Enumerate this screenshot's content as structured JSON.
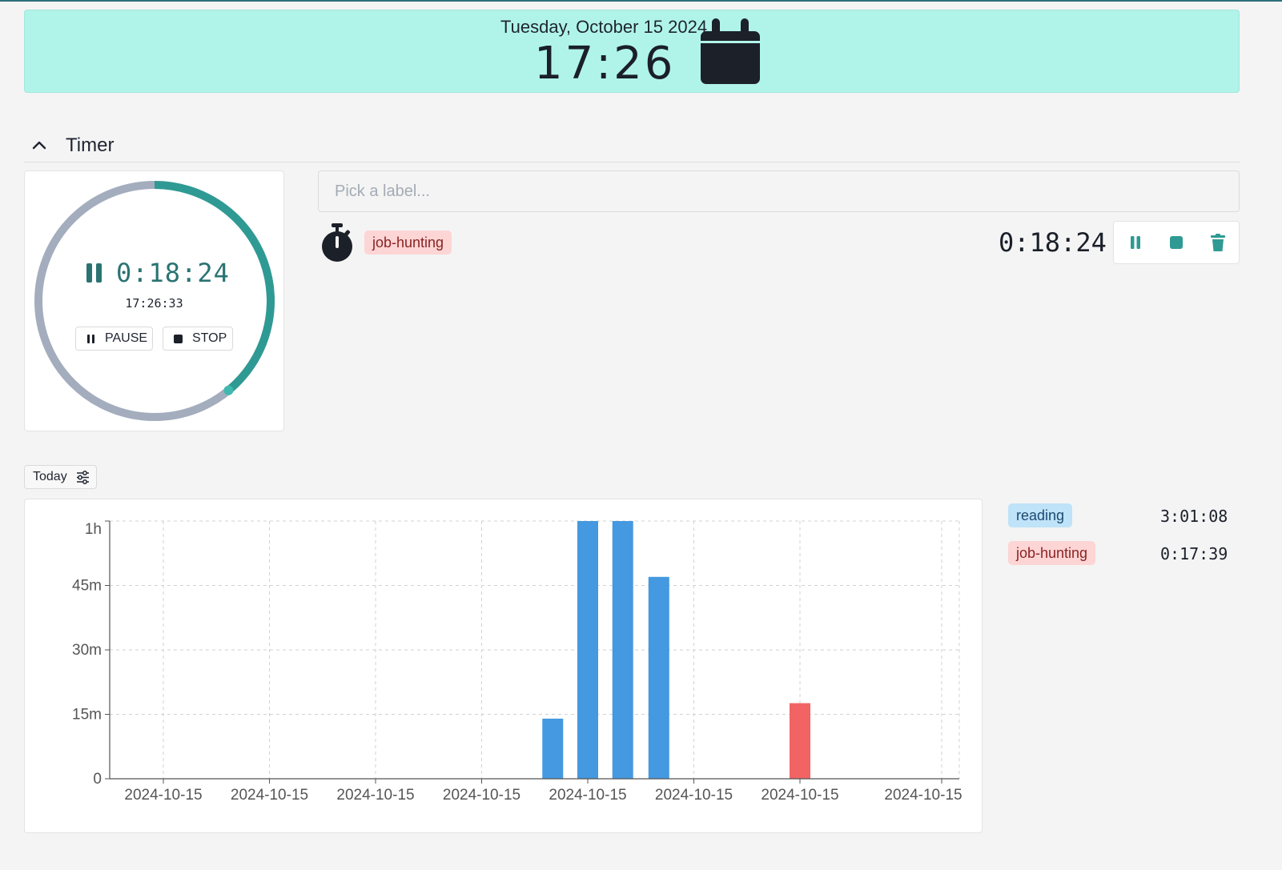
{
  "header": {
    "date": "Tuesday, October 15 2024",
    "time": "17:26",
    "icon": "calendar-icon"
  },
  "section": {
    "title": "Timer",
    "collapse_icon": "chevron-up-icon"
  },
  "timer_card": {
    "elapsed": "0:18:24",
    "clock": "17:26:33",
    "pause_label": "PAUSE",
    "stop_label": "STOP",
    "progress": 0.39,
    "ring_color": "#2f9a94",
    "track_color": "#a3adbd"
  },
  "label_input": {
    "placeholder": "Pick a label...",
    "value": ""
  },
  "active_entry": {
    "icon": "stopwatch-icon",
    "tag": "job-hunting",
    "elapsed": "0:18:24",
    "actions": [
      "pause-icon",
      "stop-icon",
      "trash-icon"
    ]
  },
  "filter": {
    "label": "Today",
    "icon": "sliders-icon"
  },
  "totals": [
    {
      "tag": "reading",
      "value": "3:01:08",
      "color": "blue"
    },
    {
      "tag": "job-hunting",
      "value": "0:17:39",
      "color": "red"
    }
  ],
  "chart_data": {
    "type": "bar",
    "y_ticks": [
      {
        "label": "0",
        "value": 0
      },
      {
        "label": "15m",
        "value": 15
      },
      {
        "label": "30m",
        "value": 30
      },
      {
        "label": "45m",
        "value": 45
      },
      {
        "label": "1h",
        "value": 60
      }
    ],
    "ylim": [
      0,
      60
    ],
    "y_unit": "minutes",
    "x_tick_labels": [
      "2024-10-15",
      "2024-10-15",
      "2024-10-15",
      "2024-10-15",
      "2024-10-15",
      "2024-10-15",
      "2024-10-15",
      "2024-10-15"
    ],
    "grid": true,
    "bars": [
      {
        "slot": 3.67,
        "value": 14,
        "series": "reading"
      },
      {
        "slot": 4.0,
        "value": 60,
        "series": "reading"
      },
      {
        "slot": 4.33,
        "value": 60,
        "series": "reading"
      },
      {
        "slot": 4.67,
        "value": 47,
        "series": "reading"
      },
      {
        "slot": 6.0,
        "value": 17.6,
        "series": "job-hunting"
      }
    ],
    "series_colors": {
      "reading": "#4499e0",
      "job-hunting": "#f26464"
    }
  }
}
